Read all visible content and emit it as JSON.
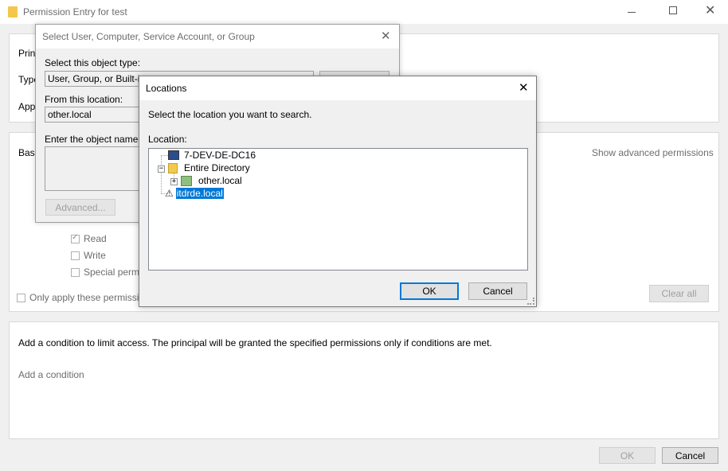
{
  "main_window": {
    "title": "Permission Entry for test",
    "principal_label": "Prin",
    "type_label": "Type",
    "applies_label": "App",
    "basic_label": "Basi",
    "show_advanced": "Show advanced permissions",
    "permissions": [
      {
        "label": "Read",
        "checked": true
      },
      {
        "label": "Write",
        "checked": false
      },
      {
        "label": "Special permi",
        "checked": false
      }
    ],
    "only_apply": "Only apply these permissio",
    "clear_all": "Clear all",
    "condition_text": "Add a condition to limit access. The principal will be granted the specified permissions only if conditions are met.",
    "add_condition": "Add a condition",
    "ok": "OK",
    "cancel": "Cancel"
  },
  "select_dialog": {
    "title": "Select User, Computer, Service Account, or Group",
    "object_type_label": "Select this object type:",
    "object_type_value": "User, Group, or Built-in se",
    "location_label": "From this location:",
    "location_value": "other.local",
    "object_name_label": "Enter the object name to",
    "advanced": "Advanced..."
  },
  "locations_dialog": {
    "title": "Locations",
    "instruction": "Select the location you want to search.",
    "location_label": "Location:",
    "tree": [
      {
        "label": "7-DEV-DE-DC16",
        "icon": "computer-icon"
      },
      {
        "label": "Entire Directory",
        "icon": "folder-icon"
      },
      {
        "label": "other.local",
        "icon": "domain-icon"
      },
      {
        "label": "itdrde.local",
        "icon": "forest-icon",
        "selected": true
      }
    ],
    "ok": "OK",
    "cancel": "Cancel"
  }
}
